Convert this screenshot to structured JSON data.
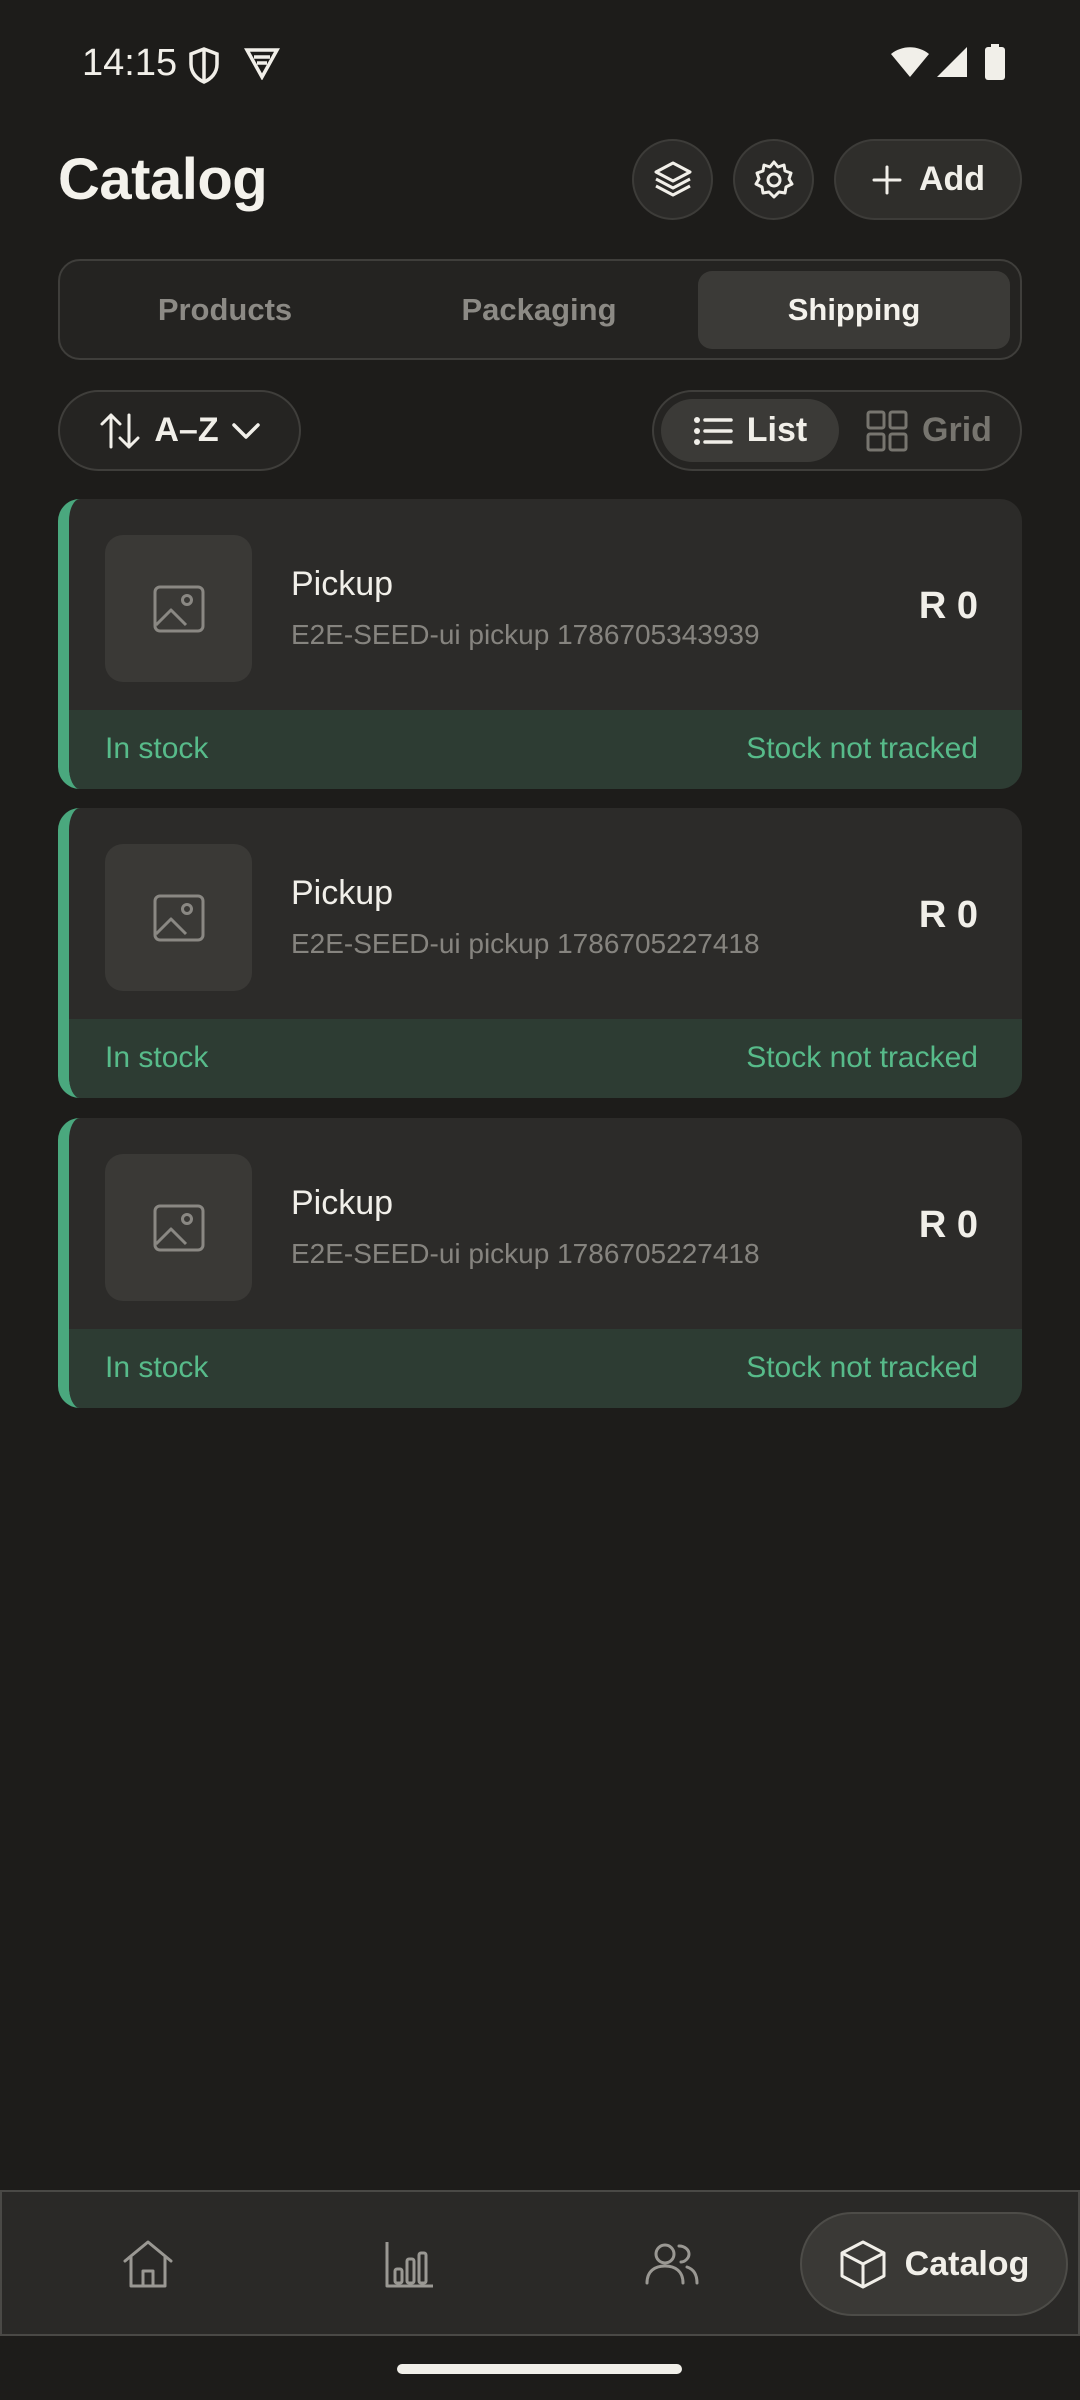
{
  "status_bar": {
    "time": "14:15"
  },
  "header": {
    "title": "Catalog",
    "add_label": "Add"
  },
  "tabs": [
    {
      "label": "Products",
      "active": false
    },
    {
      "label": "Packaging",
      "active": false
    },
    {
      "label": "Shipping",
      "active": true
    }
  ],
  "toolbar": {
    "sort_label": "A–Z",
    "view_options": [
      {
        "label": "List",
        "active": true
      },
      {
        "label": "Grid",
        "active": false
      }
    ]
  },
  "items": [
    {
      "name": "Pickup",
      "subtitle": "E2E-SEED-ui pickup 1786705343939",
      "price": "R 0",
      "status": "In stock",
      "stock_note": "Stock not tracked"
    },
    {
      "name": "Pickup",
      "subtitle": "E2E-SEED-ui pickup 1786705227418",
      "price": "R 0",
      "status": "In stock",
      "stock_note": "Stock not tracked"
    },
    {
      "name": "Pickup",
      "subtitle": "E2E-SEED-ui pickup 1786705227418",
      "price": "R 0",
      "status": "In stock",
      "stock_note": "Stock not tracked"
    }
  ],
  "bottom_nav": {
    "items": [
      {
        "icon": "home-icon",
        "label": ""
      },
      {
        "icon": "bar-chart-icon",
        "label": ""
      },
      {
        "icon": "users-icon",
        "label": ""
      },
      {
        "icon": "box-icon",
        "label": "Catalog"
      }
    ]
  },
  "colors": {
    "accent": "#4aa87e",
    "stock_text": "#57bb8a",
    "background": "#1d1c1a"
  }
}
